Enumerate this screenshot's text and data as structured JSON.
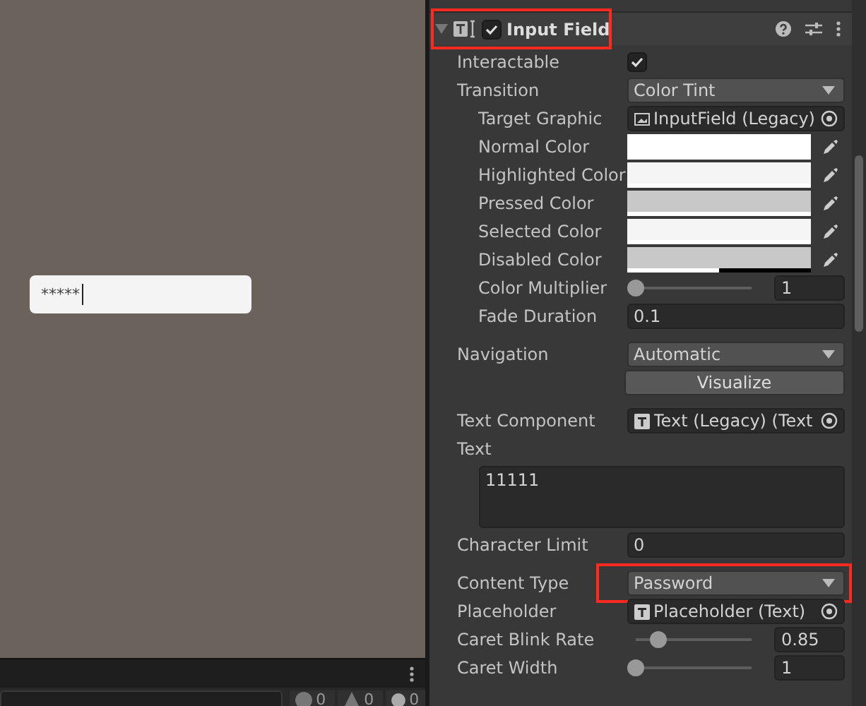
{
  "game_view": {
    "input_text": "*****"
  },
  "console": {
    "counts": [
      {
        "kind": "info",
        "text": "0"
      },
      {
        "kind": "warning",
        "text": "0"
      },
      {
        "kind": "error",
        "text": "0"
      }
    ]
  },
  "inspector": {
    "component": {
      "title": "Input Field",
      "enabled": true,
      "expanded": true,
      "annotated": true
    },
    "groups": [
      [
        {
          "kind": "checkbox",
          "label": "Interactable",
          "checked": true
        },
        {
          "kind": "dropdown",
          "label": "Transition",
          "value": "Color Tint",
          "children": [
            {
              "kind": "graphic_ref",
              "label": "Target Graphic",
              "value": "InputField (Legacy)"
            },
            {
              "kind": "color",
              "label": "Normal Color",
              "color": "#ffffff",
              "level": 1
            },
            {
              "kind": "color",
              "label": "Highlighted Color",
              "color": "#f5f5f5",
              "level": 1
            },
            {
              "kind": "color",
              "label": "Pressed Color",
              "color": "#c8c8c8",
              "level": 1
            },
            {
              "kind": "color",
              "label": "Selected Color",
              "color": "#f5f5f5",
              "level": 1
            },
            {
              "kind": "color",
              "label": "Disabled Color",
              "color": "#c8c8c8",
              "level": 0.5
            },
            {
              "kind": "slider",
              "label": "Color Multiplier",
              "level": 0,
              "value": "1"
            },
            {
              "kind": "number",
              "label": "Fade Duration",
              "value": "0.1"
            }
          ]
        }
      ],
      [
        {
          "kind": "dropdown",
          "label": "Navigation",
          "value": "Automatic"
        },
        {
          "kind": "button",
          "label": "Visualize"
        }
      ],
      [
        {
          "kind": "text_ref",
          "label": "Text Component",
          "value": "Text (Legacy) (Text"
        },
        {
          "kind": "textarea",
          "label": "Text",
          "value": "11111"
        },
        {
          "kind": "number",
          "label": "Character Limit",
          "value": "0"
        }
      ],
      [
        {
          "kind": "dropdown",
          "label": "Content Type",
          "value": "Password",
          "annotated": true
        },
        {
          "kind": "text_ref",
          "label": "Placeholder",
          "value": "Placeholder (Text)"
        },
        {
          "kind": "slider",
          "label": "Caret Blink Rate",
          "level": 0.2,
          "value": "0.85"
        },
        {
          "kind": "slider",
          "label": "Caret Width",
          "level": 0,
          "value": "1"
        }
      ]
    ]
  }
}
